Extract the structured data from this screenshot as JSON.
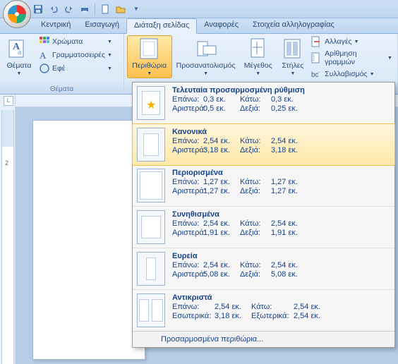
{
  "tabs": {
    "home": "Κεντρική",
    "insert": "Εισαγωγή",
    "layout": "Διάταξη σελίδας",
    "references": "Αναφορές",
    "mailings": "Στοιχεία αλληλογραφίας"
  },
  "themes": {
    "group_label": "Θέματα",
    "themes_btn": "Θέματα",
    "colors": "Χρώματα",
    "fonts": "Γραμματοσειρές",
    "effects": "Εφέ"
  },
  "page_setup": {
    "margins": "Περιθώρια",
    "orientation": "Προσανατολισμός",
    "size": "Μέγεθος",
    "columns": "Στήλες",
    "breaks": "Αλλαγές",
    "line_numbers": "Αρίθμηση γραμμών",
    "hyphenation": "Συλλαβισμός"
  },
  "ruler_corner": "L",
  "ruler_mark": "2",
  "margins_menu": {
    "items": [
      {
        "title": "Τελευταία προσαρμοσμένη ρύθμιση",
        "row1": {
          "l1": "Επάνω:",
          "v1": "0,3 εκ.",
          "l2": "Κάτω:",
          "v2": "0,3 εκ."
        },
        "row2": {
          "l1": "Αριστερά:",
          "v1": "0,5 εκ.",
          "l2": "Δεξιά:",
          "v2": "0,25 εκ."
        },
        "thumb": "star"
      },
      {
        "title": "Κανονικά",
        "row1": {
          "l1": "Επάνω:",
          "v1": "2,54 εκ.",
          "l2": "Κάτω:",
          "v2": "2,54 εκ."
        },
        "row2": {
          "l1": "Αριστερά:",
          "v1": "3,18 εκ.",
          "l2": "Δεξιά:",
          "v2": "3,18 εκ."
        },
        "thumb": "normal"
      },
      {
        "title": "Περιορισμένα",
        "row1": {
          "l1": "Επάνω:",
          "v1": "1,27 εκ.",
          "l2": "Κάτω:",
          "v2": "1,27 εκ."
        },
        "row2": {
          "l1": "Αριστερά:",
          "v1": "1,27 εκ.",
          "l2": "Δεξιά:",
          "v2": "1,27 εκ."
        },
        "thumb": "narrow"
      },
      {
        "title": "Συνηθισμένα",
        "row1": {
          "l1": "Επάνω:",
          "v1": "2,54 εκ.",
          "l2": "Κάτω:",
          "v2": "2,54 εκ."
        },
        "row2": {
          "l1": "Αριστερά:",
          "v1": "1,91 εκ.",
          "l2": "Δεξιά:",
          "v2": "1,91 εκ."
        },
        "thumb": "moderate"
      },
      {
        "title": "Ευρεία",
        "row1": {
          "l1": "Επάνω:",
          "v1": "2,54 εκ.",
          "l2": "Κάτω:",
          "v2": "2,54 εκ."
        },
        "row2": {
          "l1": "Αριστερά:",
          "v1": "5,08 εκ.",
          "l2": "Δεξιά:",
          "v2": "5,08 εκ."
        },
        "thumb": "wide"
      },
      {
        "title": "Αντικριστά",
        "row1": {
          "l1": "Επάνω:",
          "v1": "2,54 εκ.",
          "l2": "Κάτω:",
          "v2": "2,54 εκ."
        },
        "row2": {
          "l1": "Εσωτερικά:",
          "v1": "3,18 εκ.",
          "l2": "Εξωτερικά:",
          "v2": "2,54 εκ."
        },
        "thumb": "mirrored"
      }
    ],
    "custom": "Προσαρμοσμένα περιθώρια..."
  }
}
